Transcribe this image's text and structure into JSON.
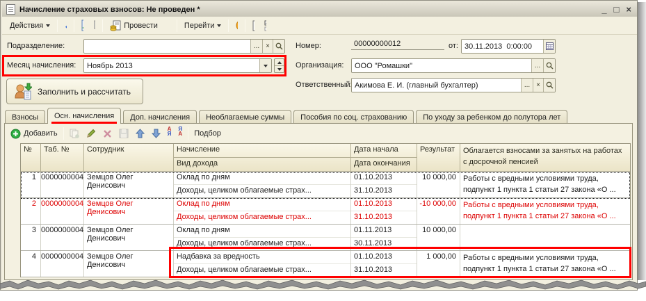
{
  "window": {
    "title": "Начисление страховых взносов: Не проведен *",
    "minimize_glyph": "_",
    "maximize_glyph": "□",
    "close_glyph": "×"
  },
  "toolbar": {
    "actions": "Действия",
    "post": "Провести",
    "go": "Перейти"
  },
  "form": {
    "department": {
      "label": "Подразделение:",
      "value": ""
    },
    "month": {
      "label": "Месяц начисления:",
      "value": "Ноябрь 2013"
    },
    "number": {
      "label": "Номер:",
      "value": "00000000012"
    },
    "date": {
      "label": "от:",
      "value": "30.11.2013  0:00:00"
    },
    "organization": {
      "label": "Организация:",
      "value": "ООО \"Ромашки\""
    },
    "responsible": {
      "label": "Ответственный:",
      "value": "Акимова Е. И. (главный бухгалтер)"
    }
  },
  "fill_button": {
    "label": "Заполнить и рассчитать"
  },
  "tabs": [
    {
      "label": "Взносы"
    },
    {
      "label": "Осн. начисления"
    },
    {
      "label": "Доп. начисления"
    },
    {
      "label": "Необлагаемые суммы"
    },
    {
      "label": "Пособия по соц. страхованию"
    },
    {
      "label": "По уходу за ребенком до полутора лет"
    }
  ],
  "active_tab": "Осн. начисления",
  "grid_toolbar": {
    "add_accel": "Д",
    "add_rest": "обавить",
    "pick": "Подбор",
    "sort_asc_top": "А",
    "sort_asc_bottom": "Я",
    "sort_desc_top": "Я",
    "sort_desc_bottom": "А"
  },
  "grid": {
    "headers": {
      "num": "№",
      "tab_num": "Таб. №",
      "employee": "Сотрудник",
      "accrual": "Начисление",
      "income_type": "Вид дохода",
      "date_start": "Дата начала",
      "date_end": "Дата окончания",
      "result": "Результат",
      "pension": "Облагается взносами за занятых на работах с досрочной пенсией"
    },
    "rows": [
      {
        "num": "1",
        "tab_num": "0000000004",
        "employee": "Земцов Олег Денисович",
        "accrual": "Оклад по дням",
        "income_type": "Доходы, целиком облагаемые страх...",
        "date_start": "01.10.2013",
        "date_end": "31.10.2013",
        "result": "10 000,00",
        "pension": "Работы с вредными условиями труда, подпункт 1 пункта 1 статьи 27 закона «О ..."
      },
      {
        "num": "2",
        "tab_num": "0000000004",
        "employee": "Земцов Олег Денисович",
        "accrual": "Оклад по дням",
        "income_type": "Доходы, целиком облагаемые страх...",
        "date_start": "01.10.2013",
        "date_end": "31.10.2013",
        "result": "-10 000,00",
        "pension": "Работы с вредными условиями труда, подпункт 1 пункта 1 статьи 27 закона «О ..."
      },
      {
        "num": "3",
        "tab_num": "0000000004",
        "employee": "Земцов Олег Денисович",
        "accrual": "Оклад по дням",
        "income_type": "Доходы, целиком облагаемые страх...",
        "date_start": "01.11.2013",
        "date_end": "30.11.2013",
        "result": "10 000,00",
        "pension": ""
      },
      {
        "num": "4",
        "tab_num": "0000000004",
        "employee": "Земцов Олег Денисович",
        "accrual": "Надбавка за вредность",
        "income_type": "Доходы, целиком облагаемые страх...",
        "date_start": "01.10.2013",
        "date_end": "31.10.2013",
        "result": "1 000,00",
        "pension": "Работы с вредными условиями труда, подпункт 1 пункта 1 статьи 27 закона «О ..."
      }
    ]
  },
  "colors": {
    "annotation": "#ff0000",
    "negative_text": "#dd0000",
    "panel_bg": "#f4f1e1"
  }
}
